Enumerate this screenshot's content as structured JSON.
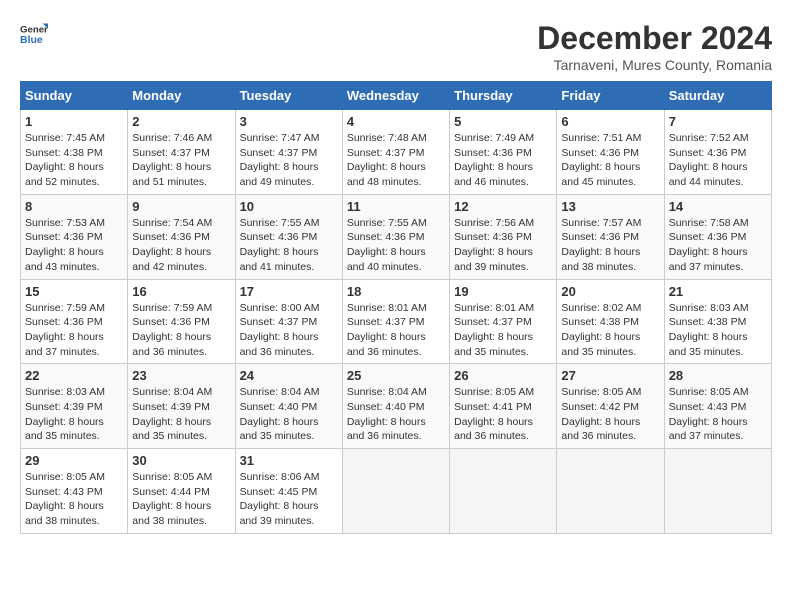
{
  "logo": {
    "general": "General",
    "blue": "Blue"
  },
  "title": "December 2024",
  "location": "Tarnaveni, Mures County, Romania",
  "days_header": [
    "Sunday",
    "Monday",
    "Tuesday",
    "Wednesday",
    "Thursday",
    "Friday",
    "Saturday"
  ],
  "weeks": [
    [
      {
        "day": "1",
        "sunrise": "7:45 AM",
        "sunset": "4:38 PM",
        "daylight": "8 hours and 52 minutes."
      },
      {
        "day": "2",
        "sunrise": "7:46 AM",
        "sunset": "4:37 PM",
        "daylight": "8 hours and 51 minutes."
      },
      {
        "day": "3",
        "sunrise": "7:47 AM",
        "sunset": "4:37 PM",
        "daylight": "8 hours and 49 minutes."
      },
      {
        "day": "4",
        "sunrise": "7:48 AM",
        "sunset": "4:37 PM",
        "daylight": "8 hours and 48 minutes."
      },
      {
        "day": "5",
        "sunrise": "7:49 AM",
        "sunset": "4:36 PM",
        "daylight": "8 hours and 46 minutes."
      },
      {
        "day": "6",
        "sunrise": "7:51 AM",
        "sunset": "4:36 PM",
        "daylight": "8 hours and 45 minutes."
      },
      {
        "day": "7",
        "sunrise": "7:52 AM",
        "sunset": "4:36 PM",
        "daylight": "8 hours and 44 minutes."
      }
    ],
    [
      {
        "day": "8",
        "sunrise": "7:53 AM",
        "sunset": "4:36 PM",
        "daylight": "8 hours and 43 minutes."
      },
      {
        "day": "9",
        "sunrise": "7:54 AM",
        "sunset": "4:36 PM",
        "daylight": "8 hours and 42 minutes."
      },
      {
        "day": "10",
        "sunrise": "7:55 AM",
        "sunset": "4:36 PM",
        "daylight": "8 hours and 41 minutes."
      },
      {
        "day": "11",
        "sunrise": "7:55 AM",
        "sunset": "4:36 PM",
        "daylight": "8 hours and 40 minutes."
      },
      {
        "day": "12",
        "sunrise": "7:56 AM",
        "sunset": "4:36 PM",
        "daylight": "8 hours and 39 minutes."
      },
      {
        "day": "13",
        "sunrise": "7:57 AM",
        "sunset": "4:36 PM",
        "daylight": "8 hours and 38 minutes."
      },
      {
        "day": "14",
        "sunrise": "7:58 AM",
        "sunset": "4:36 PM",
        "daylight": "8 hours and 37 minutes."
      }
    ],
    [
      {
        "day": "15",
        "sunrise": "7:59 AM",
        "sunset": "4:36 PM",
        "daylight": "8 hours and 37 minutes."
      },
      {
        "day": "16",
        "sunrise": "7:59 AM",
        "sunset": "4:36 PM",
        "daylight": "8 hours and 36 minutes."
      },
      {
        "day": "17",
        "sunrise": "8:00 AM",
        "sunset": "4:37 PM",
        "daylight": "8 hours and 36 minutes."
      },
      {
        "day": "18",
        "sunrise": "8:01 AM",
        "sunset": "4:37 PM",
        "daylight": "8 hours and 36 minutes."
      },
      {
        "day": "19",
        "sunrise": "8:01 AM",
        "sunset": "4:37 PM",
        "daylight": "8 hours and 35 minutes."
      },
      {
        "day": "20",
        "sunrise": "8:02 AM",
        "sunset": "4:38 PM",
        "daylight": "8 hours and 35 minutes."
      },
      {
        "day": "21",
        "sunrise": "8:03 AM",
        "sunset": "4:38 PM",
        "daylight": "8 hours and 35 minutes."
      }
    ],
    [
      {
        "day": "22",
        "sunrise": "8:03 AM",
        "sunset": "4:39 PM",
        "daylight": "8 hours and 35 minutes."
      },
      {
        "day": "23",
        "sunrise": "8:04 AM",
        "sunset": "4:39 PM",
        "daylight": "8 hours and 35 minutes."
      },
      {
        "day": "24",
        "sunrise": "8:04 AM",
        "sunset": "4:40 PM",
        "daylight": "8 hours and 35 minutes."
      },
      {
        "day": "25",
        "sunrise": "8:04 AM",
        "sunset": "4:40 PM",
        "daylight": "8 hours and 36 minutes."
      },
      {
        "day": "26",
        "sunrise": "8:05 AM",
        "sunset": "4:41 PM",
        "daylight": "8 hours and 36 minutes."
      },
      {
        "day": "27",
        "sunrise": "8:05 AM",
        "sunset": "4:42 PM",
        "daylight": "8 hours and 36 minutes."
      },
      {
        "day": "28",
        "sunrise": "8:05 AM",
        "sunset": "4:43 PM",
        "daylight": "8 hours and 37 minutes."
      }
    ],
    [
      {
        "day": "29",
        "sunrise": "8:05 AM",
        "sunset": "4:43 PM",
        "daylight": "8 hours and 38 minutes."
      },
      {
        "day": "30",
        "sunrise": "8:05 AM",
        "sunset": "4:44 PM",
        "daylight": "8 hours and 38 minutes."
      },
      {
        "day": "31",
        "sunrise": "8:06 AM",
        "sunset": "4:45 PM",
        "daylight": "8 hours and 39 minutes."
      },
      null,
      null,
      null,
      null
    ]
  ]
}
